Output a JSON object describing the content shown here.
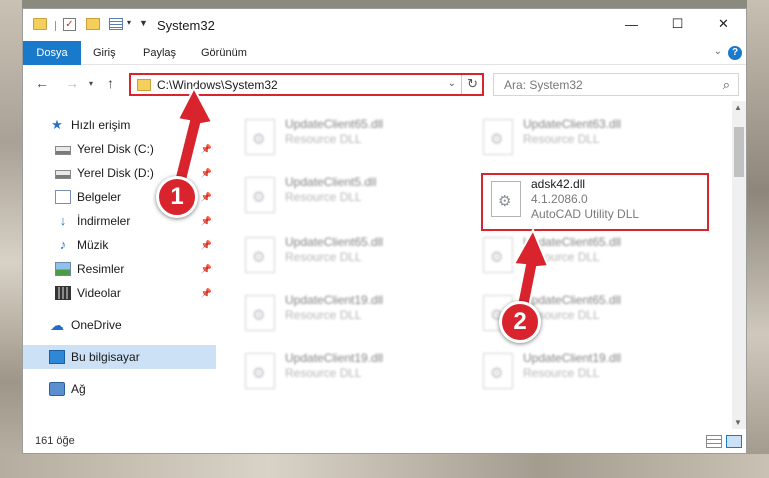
{
  "window": {
    "title": "System32"
  },
  "title_buttons": {
    "minimize": "—",
    "maximize": "☐",
    "close": "✕"
  },
  "ribbon": {
    "tabs": [
      "Dosya",
      "Giriş",
      "Paylaş",
      "Görünüm"
    ],
    "help": "?"
  },
  "navigation": {
    "address": "C:\\Windows\\System32",
    "search_placeholder": "Ara: System32"
  },
  "sidebar": {
    "items": [
      {
        "label": "Hızlı erişim",
        "icon": "star-icon",
        "pinned": false
      },
      {
        "label": "Yerel Disk (C:)",
        "icon": "drive-icon",
        "pinned": true
      },
      {
        "label": "Yerel Disk (D:)",
        "icon": "drive-icon",
        "pinned": true
      },
      {
        "label": "Belgeler",
        "icon": "documents-icon",
        "pinned": true
      },
      {
        "label": "İndirmeler",
        "icon": "download-icon",
        "pinned": true
      },
      {
        "label": "Müzik",
        "icon": "music-icon",
        "pinned": true
      },
      {
        "label": "Resimler",
        "icon": "pictures-icon",
        "pinned": true
      },
      {
        "label": "Videolar",
        "icon": "videos-icon",
        "pinned": true
      },
      {
        "label": "OneDrive",
        "icon": "cloud-icon",
        "pinned": false
      },
      {
        "label": "Bu bilgisayar",
        "icon": "computer-icon",
        "pinned": false,
        "selected": true
      },
      {
        "label": "Ağ",
        "icon": "network-icon",
        "pinned": false
      }
    ]
  },
  "files": {
    "left_column": [
      {
        "name": "UpdateClient65.dll",
        "type": "Resource DLL"
      },
      {
        "name": "UpdateClient5.dll",
        "type": "Resource DLL"
      },
      {
        "name": "UpdateClient65.dll",
        "type": "Resource DLL"
      },
      {
        "name": "UpdateClient19.dll",
        "type": "Resource DLL"
      },
      {
        "name": "UpdateClient19.dll",
        "type": "Resource DLL"
      }
    ],
    "right_column": [
      {
        "name": "UpdateClient63.dll",
        "type": "Resource DLL"
      },
      {
        "name": "UpdateClient65.dll",
        "type": "Resource DLL"
      },
      {
        "name": "UpdateClient65.dll",
        "type": "Resource DLL"
      },
      {
        "name": "UpdateClient19.dll",
        "type": "Resource DLL"
      }
    ],
    "highlighted": {
      "name": "adsk42.dll",
      "version": "4.1.2086.0",
      "description": "AutoCAD Utility DLL"
    }
  },
  "status": {
    "item_count": "161 öğe"
  },
  "annotations": {
    "step1": "1",
    "step2": "2",
    "accent_color": "#d9242e"
  }
}
